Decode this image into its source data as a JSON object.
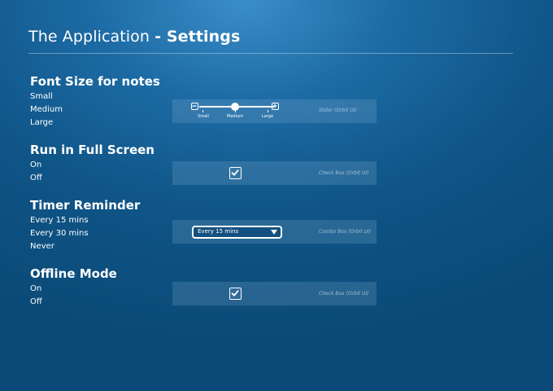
{
  "header": {
    "app_name": "The Application",
    "page_name": "- Settings"
  },
  "sections": [
    {
      "heading": "Font Size for notes",
      "options": [
        "Small",
        "Medium",
        "Large"
      ],
      "control": {
        "type": "slider",
        "note": "Slider (Orbit UI)",
        "ticks": [
          "Small",
          "Medium",
          "Large"
        ],
        "selected": "Medium",
        "decrease_icon": "minus-box-icon",
        "increase_icon": "plus-box-icon"
      }
    },
    {
      "heading": "Run in Full Screen",
      "options": [
        "On",
        "Off"
      ],
      "control": {
        "type": "checkbox",
        "note": "Check Box (Orbit UI)",
        "checked": true,
        "icon": "checkmark-icon"
      }
    },
    {
      "heading": "Timer Reminder",
      "options": [
        "Every 15 mins",
        "Every 30 mins",
        "Never"
      ],
      "control": {
        "type": "combobox",
        "note": "Combo Box (Orbit UI)",
        "value": "Every 15 mins",
        "icon": "triangle-down-icon"
      }
    },
    {
      "heading": "Offline Mode",
      "options": [
        "On",
        "Off"
      ],
      "control": {
        "type": "checkbox",
        "note": "Check Box (Orbit UI)",
        "checked": true,
        "icon": "checkmark-icon"
      }
    }
  ],
  "colors": {
    "background": "#0f5587",
    "background_highlight": "#3a8ec8",
    "panel": "rgba(140,180,215,0.22)",
    "text": "#ffffff"
  }
}
